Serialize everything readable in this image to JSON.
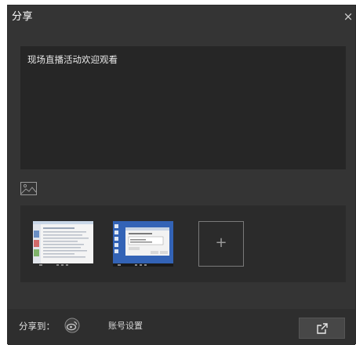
{
  "dialog": {
    "title": "分享",
    "close_glyph": "×"
  },
  "message": {
    "text": "现场直播活动欢迎观看"
  },
  "attachments": {
    "add_glyph": "+"
  },
  "footer": {
    "share_to_label": "分享到：",
    "account_settings_label": "账号设置"
  },
  "icons": {
    "image": "image-icon",
    "weibo": "weibo-icon",
    "share": "share-export-icon",
    "close": "close-icon"
  },
  "colors": {
    "dialog_bg": "#343434",
    "textarea_bg": "#262626",
    "panel_bg": "#2b2b2b",
    "footer_bg": "#2e2e2e",
    "button_bg": "#474747"
  }
}
